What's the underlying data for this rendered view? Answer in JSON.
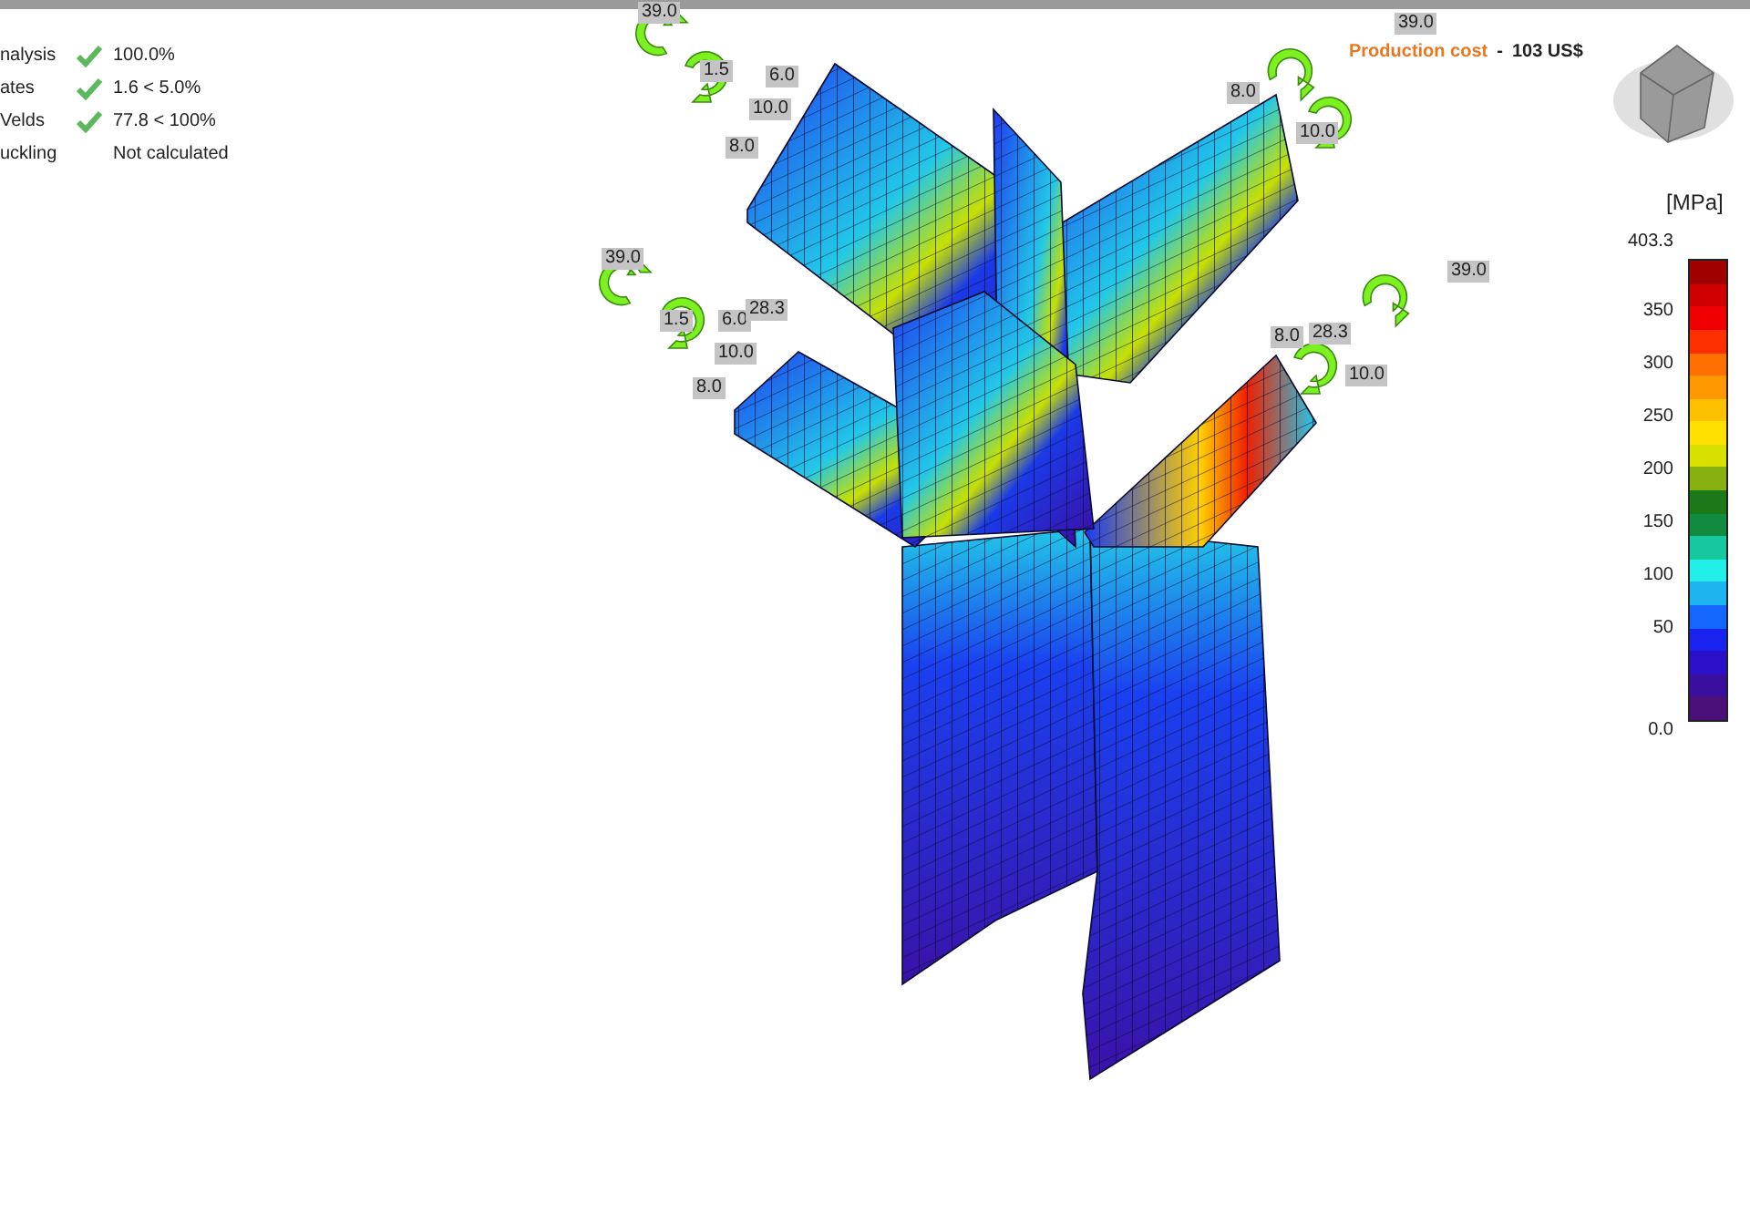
{
  "checks": [
    {
      "label": "nalysis",
      "ok": true,
      "value": "100.0%"
    },
    {
      "label": "ates",
      "ok": true,
      "value": "1.6 < 5.0%"
    },
    {
      "label": "Velds",
      "ok": true,
      "value": "77.8 < 100%"
    },
    {
      "label": "uckling",
      "ok": false,
      "value": "Not calculated"
    }
  ],
  "production_cost": {
    "label": "Production cost",
    "separator": "-",
    "value": "103 US$"
  },
  "loads": [
    {
      "text": "39.0"
    },
    {
      "text": "1.5"
    },
    {
      "text": "6.0"
    },
    {
      "text": "10.0"
    },
    {
      "text": "8.0"
    },
    {
      "text": "39.0"
    },
    {
      "text": "8.0"
    },
    {
      "text": "10.0"
    },
    {
      "text": "39.0"
    },
    {
      "text": "1.5"
    },
    {
      "text": "6.0"
    },
    {
      "text": "28.3"
    },
    {
      "text": "10.0"
    },
    {
      "text": "8.0"
    },
    {
      "text": "39.0"
    },
    {
      "text": "8.0"
    },
    {
      "text": "28.3"
    },
    {
      "text": "10.0"
    }
  ],
  "legend": {
    "unit": "[MPa]",
    "ticks": [
      "403.3",
      "350",
      "300",
      "250",
      "200",
      "150",
      "100",
      "50",
      "0.0"
    ]
  }
}
